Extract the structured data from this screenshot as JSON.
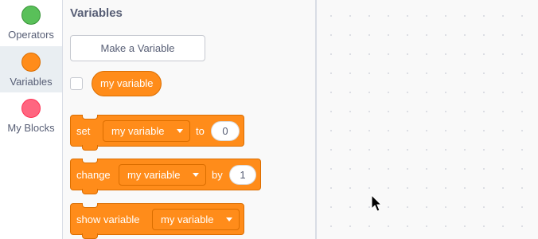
{
  "categories": [
    {
      "label": "Operators",
      "color": "#59c059",
      "selected": false
    },
    {
      "label": "Variables",
      "color": "#ff8c1a",
      "selected": true
    },
    {
      "label": "My Blocks",
      "color": "#ff6680",
      "selected": false
    }
  ],
  "palette": {
    "title": "Variables",
    "make_variable_label": "Make a Variable",
    "variable_reporter": "my variable",
    "blocks": {
      "set": {
        "prefix": "set",
        "variable": "my variable",
        "mid": "to",
        "value": "0"
      },
      "change": {
        "prefix": "change",
        "variable": "my variable",
        "mid": "by",
        "value": "1"
      },
      "show": {
        "prefix": "show variable",
        "variable": "my variable"
      }
    }
  },
  "colors": {
    "variables_block": "#ff8c1a",
    "variables_block_border": "#db6e00"
  }
}
